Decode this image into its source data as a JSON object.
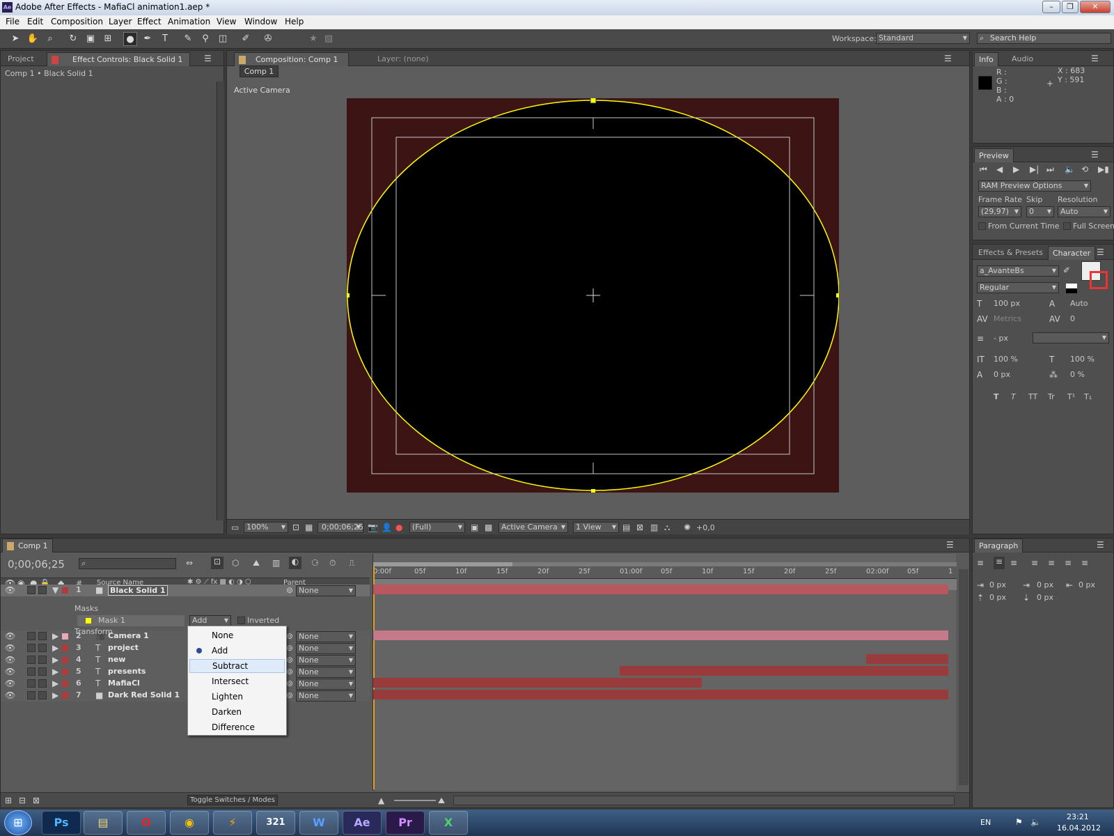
{
  "window": {
    "title": "Adobe After Effects - MafiaCl animation1.aep *",
    "app_icon": "Ae"
  },
  "menu": [
    "File",
    "Edit",
    "Composition",
    "Layer",
    "Effect",
    "View",
    "Window",
    "Animation",
    "Help"
  ],
  "menu_order": [
    "File",
    "Edit",
    "Composition",
    "Layer",
    "Effect",
    "Animation",
    "View",
    "Window",
    "Help"
  ],
  "workspace": {
    "label": "Workspace:",
    "value": "Standard"
  },
  "search_help": {
    "placeholder": "Search Help"
  },
  "project_panel": {
    "tab_project": "Project",
    "tab_effect_controls": "Effect Controls: Black Solid 1",
    "breadcrumb": "Comp 1 • Black Solid 1"
  },
  "comp_panel": {
    "tab_composition": "Composition: Comp 1",
    "tab_layer": "Layer: (none)",
    "comp_button": "Comp 1",
    "active_camera": "Active Camera",
    "zoom": "100%",
    "timecode": "0;00;06;25",
    "resolution": "(Full)",
    "camera": "Active Camera",
    "views": "1 View",
    "exposure": "+0,0"
  },
  "info_panel": {
    "tab_info": "Info",
    "tab_audio": "Audio",
    "r": "R :",
    "g": "G :",
    "b": "B :",
    "a": "A : 0",
    "x": "X : 683",
    "y": "Y : 591"
  },
  "preview_panel": {
    "tab": "Preview",
    "ram_options": "RAM Preview Options",
    "frame_rate_label": "Frame Rate",
    "skip_label": "Skip",
    "resolution_label": "Resolution",
    "frame_rate": "(29,97)",
    "skip": "0",
    "resolution": "Auto",
    "from_current": "From Current Time",
    "full_screen": "Full Screen"
  },
  "character_panel": {
    "tab_effects": "Effects & Presets",
    "tab_character": "Character",
    "font": "a_AvanteBs",
    "style": "Regular",
    "size": "100 px",
    "leading": "Auto",
    "kerning": "Metrics",
    "tracking": "0",
    "stroke": "- px",
    "vscale": "100 %",
    "hscale": "100 %",
    "baseline": "0 px",
    "tsume": "0 %",
    "styles": [
      "T",
      "T",
      "TT",
      "Tr",
      "T¹",
      "T₁"
    ]
  },
  "paragraph_panel": {
    "tab": "Paragraph",
    "indent_left": "0 px",
    "indent_first": "0 px",
    "indent_right": "0 px",
    "space_before": "0 px",
    "space_after": "0 px"
  },
  "timeline": {
    "tab": "Comp 1",
    "timecode": "0;00;06;25",
    "ruler": [
      "0:00f",
      "05f",
      "10f",
      "15f",
      "20f",
      "25f",
      "01:00f",
      "05f",
      "10f",
      "15f",
      "20f",
      "25f",
      "02:00f",
      "05f",
      "1"
    ],
    "columns": {
      "num": "#",
      "source": "Source Name",
      "parent": "Parent"
    },
    "layers": [
      {
        "num": "1",
        "name": "Black Solid 1",
        "color": "#b33a3a",
        "icon": "solid-icon",
        "parent": "None",
        "bar_color": "#b8585e"
      },
      {
        "num": "2",
        "name": "Camera 1",
        "color": "#e8a8b4",
        "icon": "camera-icon",
        "parent": "None",
        "bar_color": "#c47a8a"
      },
      {
        "num": "3",
        "name": "project",
        "color": "#b33a3a",
        "icon": "text-icon",
        "parent": "None"
      },
      {
        "num": "4",
        "name": "new",
        "color": "#b33a3a",
        "icon": "text-icon",
        "parent": "None",
        "bar_color": "#9a3b3b"
      },
      {
        "num": "5",
        "name": "presents",
        "color": "#b33a3a",
        "icon": "text-icon",
        "parent": "None",
        "bar_color": "#9a3b3b"
      },
      {
        "num": "6",
        "name": "MafiaCl",
        "color": "#b33a3a",
        "icon": "text-icon",
        "parent": "None",
        "bar_color": "#9a3b3b"
      },
      {
        "num": "7",
        "name": "Dark Red Solid 1",
        "color": "#b33a3a",
        "icon": "solid-icon",
        "parent": "None",
        "bar_color": "#9a3b3b"
      }
    ],
    "masks_label": "Masks",
    "mask_name": "Mask 1",
    "mask_mode": "Add",
    "inverted": "Inverted",
    "transform_label": "Transform",
    "toggle": "Toggle Switches / Modes"
  },
  "mask_mode_menu": {
    "items": [
      "None",
      "Add",
      "Subtract",
      "Intersect",
      "Lighten",
      "Darken",
      "Difference"
    ],
    "selected": "Add",
    "hover": "Subtract"
  },
  "taskbar": {
    "apps": [
      "Ps",
      "Explorer",
      "Opera",
      "Chrome",
      "Winamp",
      "321",
      "W",
      "Ae",
      "Pr",
      "X"
    ],
    "lang": "EN",
    "time": "23:21",
    "date": "16.04.2012"
  },
  "colors": {
    "accent": "#e2a12a",
    "mask": "#ffff00",
    "bg_comp": "#3c1414"
  }
}
